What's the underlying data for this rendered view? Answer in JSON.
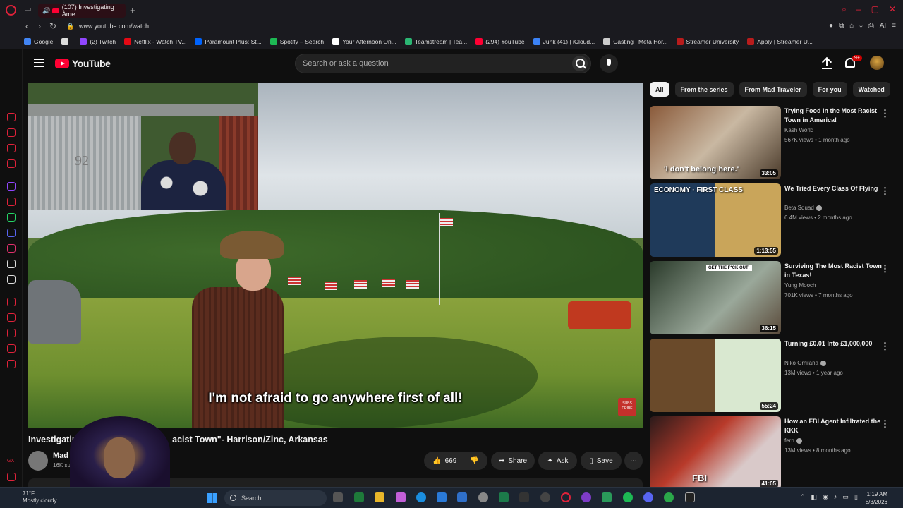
{
  "browser": {
    "tab_title": "(107) Investigating Ame",
    "url": "www.youtube.com/watch",
    "bookmarks": [
      {
        "label": "Google",
        "color": "#4285f4"
      },
      {
        "label": "",
        "color": "#dddddd"
      },
      {
        "label": "(2) Twitch",
        "color": "#9146ff"
      },
      {
        "label": "Netflix - Watch TV...",
        "color": "#e50914"
      },
      {
        "label": "Paramount Plus: St...",
        "color": "#0064ff"
      },
      {
        "label": "Spotify – Search",
        "color": "#1db954"
      },
      {
        "label": "Your Afternoon On...",
        "color": "#ffffff"
      },
      {
        "label": "Teamstream | Tea...",
        "color": "#2bb673"
      },
      {
        "label": "(294) YouTube",
        "color": "#ff0033"
      },
      {
        "label": "Junk (41) | iCloud...",
        "color": "#3b82f6"
      },
      {
        "label": "Casting | Meta Hor...",
        "color": "#cccccc"
      },
      {
        "label": "Streamer University",
        "color": "#b91c1c"
      },
      {
        "label": "Apply | Streamer U...",
        "color": "#b91c1c"
      }
    ]
  },
  "youtube": {
    "logo_text": "YouTube",
    "search_placeholder": "Search or ask a question",
    "notification_count": "9+"
  },
  "video": {
    "caption": "I'm not afraid to go anywhere first of all!",
    "title_left": "Investigating A",
    "title_right": "acist Town\"- Harrison/Zinc, Arkansas",
    "channel_name": "Mad Tra",
    "channel_subs": "16K subs",
    "like_count": "669",
    "share_label": "Share",
    "ask_label": "Ask",
    "save_label": "Save",
    "subscribe_badge": "SUBS CRIBE",
    "inset_text": "92"
  },
  "chips": [
    "All",
    "From the series",
    "From Mad Traveler",
    "For you",
    "Watched"
  ],
  "recommendations": [
    {
      "title": "Trying Food in the Most Racist Town in America!",
      "channel": "Kash World",
      "meta": "567K views • 1 month ago",
      "duration": "33:05",
      "thumb_text": "'i don't belong here.'",
      "verified": false
    },
    {
      "title": "We Tried Every Class Of Flying",
      "channel": "Beta Squad",
      "meta": "6.4M views • 2 months ago",
      "duration": "1:13:55",
      "thumb_text": "ECONOMY · FIRST CLASS",
      "verified": true
    },
    {
      "title": "Surviving The Most Racist Town in Texas!",
      "channel": "Yung Mooch",
      "meta": "701K views • 7 months ago",
      "duration": "36:15",
      "thumb_text": "GET THE F*CK OUT!",
      "verified": false
    },
    {
      "title": "Turning £0.01 Into £1,000,000",
      "channel": "Niko Omilana",
      "meta": "13M views • 1 year ago",
      "duration": "55:24",
      "thumb_text": "",
      "verified": true
    },
    {
      "title": "How an FBI Agent Infiltrated the KKK",
      "channel": "fern",
      "meta": "13M views • 8 months ago",
      "duration": "41:05",
      "thumb_text": "FBI",
      "verified": true
    }
  ],
  "taskbar": {
    "weather_temp": "71°F",
    "weather_desc": "Mostly cloudy",
    "search_label": "Search",
    "time": "1:19 AM",
    "date": "8/3/2026"
  }
}
